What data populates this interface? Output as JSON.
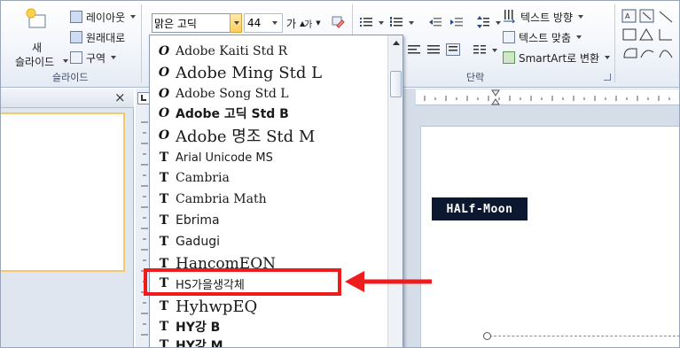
{
  "ribbon": {
    "slides_group": {
      "new_slide_line1": "새",
      "new_slide_line2": "슬라이드",
      "layout": "레이아웃",
      "reset": "원래대로",
      "section": "구역",
      "group_label": "슬라이드"
    },
    "font": {
      "name_value": "맑은 고딕",
      "size_value": "44",
      "grow_glyph": "가",
      "shrink_glyph": "가"
    },
    "paragraph": {
      "text_direction": "텍스트 방향",
      "align_text": "텍스트 맞춤",
      "smartart": "SmartArt로 변환",
      "group_label": "단락"
    }
  },
  "pane": {
    "close_glyph": "×"
  },
  "slide": {
    "wordart_text": "HALf-Moon"
  },
  "font_list": {
    "items": [
      {
        "name": "Adobe Kaiti Std R",
        "icon": "O",
        "kind": "otf",
        "size": 14,
        "bold": false,
        "family": "serif"
      },
      {
        "name": "Adobe Ming Std L",
        "icon": "O",
        "kind": "otf",
        "size": 18,
        "bold": false,
        "family": "serif"
      },
      {
        "name": "Adobe Song Std L",
        "icon": "O",
        "kind": "otf",
        "size": 14,
        "bold": false,
        "family": "serif"
      },
      {
        "name": "Adobe 고딕 Std B",
        "icon": "O",
        "kind": "otf",
        "size": 14,
        "bold": true,
        "family": "sans"
      },
      {
        "name": "Adobe 명조 Std M",
        "icon": "O",
        "kind": "otf",
        "size": 18,
        "bold": false,
        "family": "serif"
      },
      {
        "name": "Arial Unicode MS",
        "icon": "T",
        "kind": "ttf",
        "size": 13,
        "bold": false,
        "family": "sans"
      },
      {
        "name": "Cambria",
        "icon": "T",
        "kind": "ttf",
        "size": 14,
        "bold": false,
        "family": "serif"
      },
      {
        "name": "Cambria Math",
        "icon": "T",
        "kind": "ttf",
        "size": 14,
        "bold": false,
        "family": "serif"
      },
      {
        "name": "Ebrima",
        "icon": "T",
        "kind": "ttf",
        "size": 14,
        "bold": false,
        "family": "sans"
      },
      {
        "name": "Gadugi",
        "icon": "T",
        "kind": "ttf",
        "size": 14,
        "bold": false,
        "family": "sans"
      },
      {
        "name": "HancomEQN",
        "icon": "T",
        "kind": "ttf",
        "size": 17,
        "bold": false,
        "family": "serif"
      },
      {
        "name": "HS가을생각체",
        "icon": "T",
        "kind": "ttf",
        "size": 13,
        "bold": false,
        "family": "sans"
      },
      {
        "name": "HyhwpEQ",
        "icon": "T",
        "kind": "ttf",
        "size": 18,
        "bold": false,
        "family": "serif"
      },
      {
        "name": "HY강 B",
        "icon": "T",
        "kind": "ttf",
        "size": 14,
        "bold": true,
        "family": "sans"
      },
      {
        "name": "HY강 M",
        "icon": "T",
        "kind": "ttf",
        "size": 14,
        "bold": true,
        "family": "sans"
      }
    ]
  },
  "colors": {
    "highlight": "#ee1c1c",
    "selected_combo": "#ffcf5e"
  }
}
